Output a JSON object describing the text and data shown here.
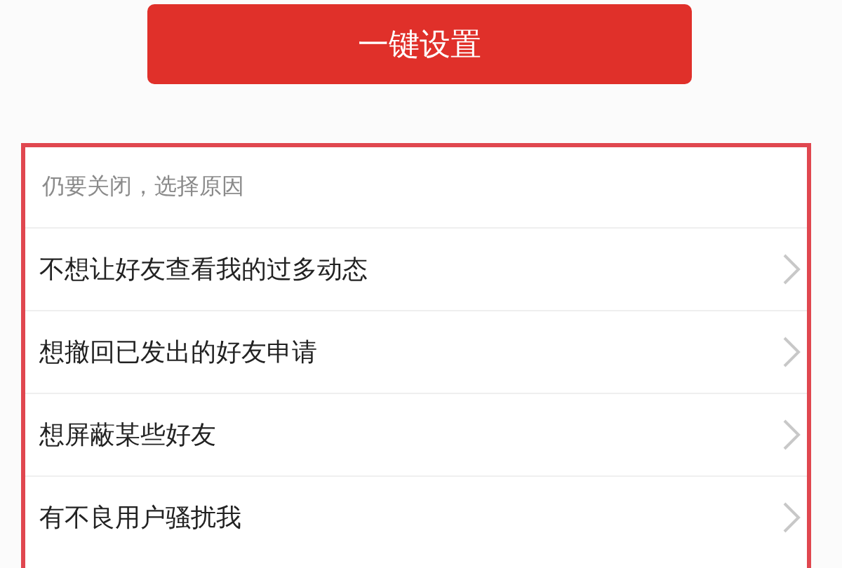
{
  "button": {
    "label": "一键设置"
  },
  "reasons": {
    "header": "仍要关闭，选择原因",
    "items": [
      {
        "label": "不想让好友查看我的过多动态"
      },
      {
        "label": "想撤回已发出的好友申请"
      },
      {
        "label": "想屏蔽某些好友"
      },
      {
        "label": "有不良用户骚扰我"
      }
    ]
  }
}
